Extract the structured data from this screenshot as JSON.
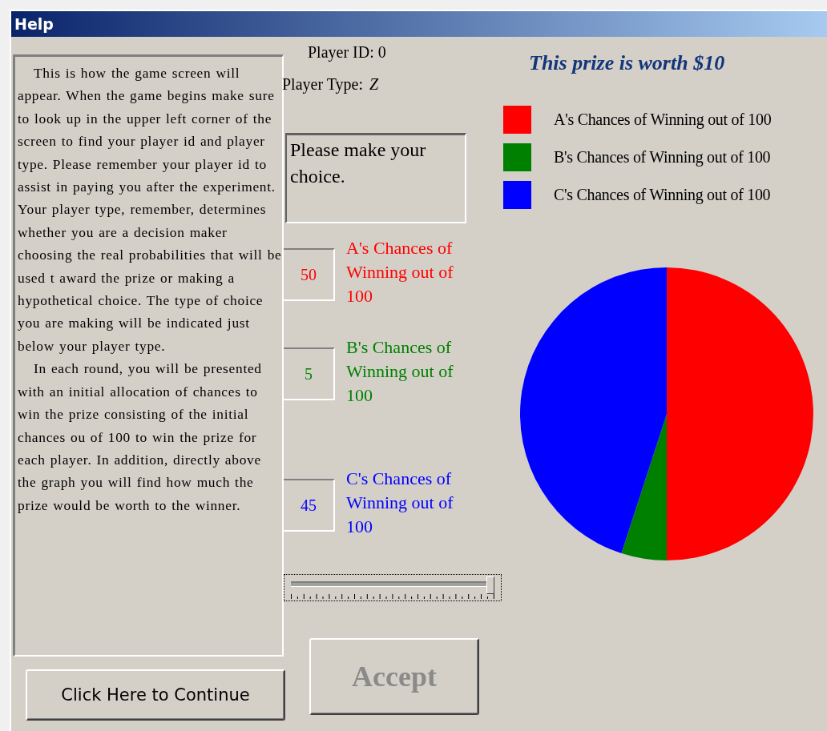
{
  "window": {
    "title": "Help"
  },
  "help_text": [
    "This is how the game screen will appear. When the game begins make sure to look up in the upper left corner of the screen to find your player id and player type. Please remember your player id to assist in paying you after the experiment. Your player type, remember, determines whether you are a decision maker choosing the real probabilities that will be used t award the prize or making a hypothetical choice. The type of choice you are making will be indicated just below your player type.",
    "In each round, you will be presented with an initial allocation of chances to win the prize consisting of the initial chances ou of 100 to win the prize for each player. In addition, directly above the graph you will find how much the prize would be worth to the winner."
  ],
  "continue_button": "Click Here to Continue",
  "player_id": "Player ID: 0",
  "player_type": {
    "label": "Player Type:",
    "value": "Z"
  },
  "message": "Please make your choice.",
  "chances": [
    {
      "value": "50",
      "label": "A's Chances of Winning out of 100",
      "color": "#ff0000"
    },
    {
      "value": "5",
      "label": "B's Chances of Winning out of 100",
      "color": "#008000"
    },
    {
      "value": "45",
      "label": "C's Chances of Winning out of 100",
      "color": "#0000ff"
    }
  ],
  "slider": {
    "level": 0.98
  },
  "accept_button": {
    "label": "Accept",
    "disabled": true
  },
  "prize_title": "This prize is worth $10",
  "chart_data": {
    "type": "pie",
    "categories": [
      "A's Chances of Winning out of 100",
      "B's Chances of Winning out of 100",
      "C's Chances of Winning out of 100"
    ],
    "values": [
      50,
      5,
      45
    ],
    "colors": [
      "#ff0000",
      "#008000",
      "#0000ff"
    ]
  }
}
